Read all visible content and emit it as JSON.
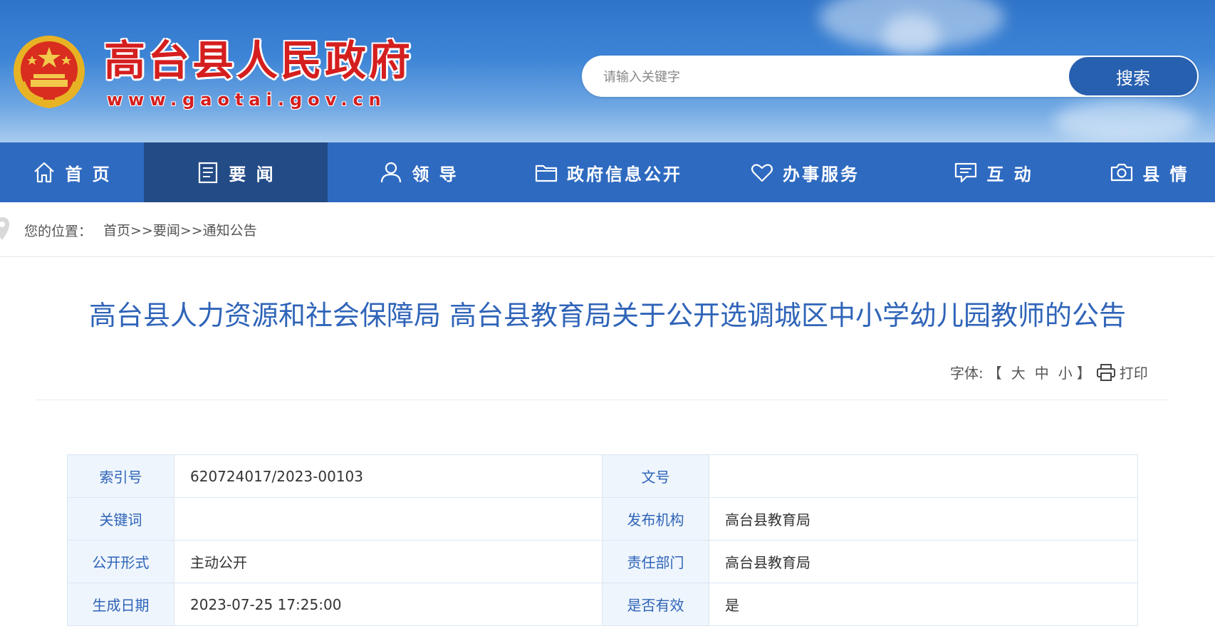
{
  "header": {
    "site_name": "高台县人民政府",
    "site_url": "www.gaotai.gov.cn",
    "colors": {
      "site_name": "#d51e1e",
      "banner": "#2f74c9"
    }
  },
  "search": {
    "placeholder": "请输入关键字",
    "button_label": "搜索"
  },
  "nav": {
    "items": [
      {
        "label": "首 页",
        "icon": "home-icon"
      },
      {
        "label": "要 闻",
        "icon": "news-icon",
        "active": true
      },
      {
        "label": "领 导",
        "icon": "person-icon"
      },
      {
        "label": "政府信息公开",
        "icon": "folder-icon"
      },
      {
        "label": "办事服务",
        "icon": "heart-icon"
      },
      {
        "label": "互 动",
        "icon": "chat-icon"
      },
      {
        "label": "县 情",
        "icon": "camera-icon"
      }
    ],
    "colors": {
      "bar": "#2e6ac0",
      "active": "#234b86"
    }
  },
  "breadcrumb": {
    "label": "您的位置：",
    "path": "首页>>要闻>>通知公告"
  },
  "article": {
    "title": "高台县人力资源和社会保障局 高台县教育局关于公开选调城区中小学幼儿园教师的公告",
    "font_label": "字体:",
    "font_open": "【",
    "font_large": "大",
    "font_medium": "中",
    "font_small": "小",
    "font_close": "】",
    "print_label": "打印"
  },
  "meta": {
    "rows": [
      [
        {
          "label": "索引号",
          "value": "620724017/2023-00103"
        },
        {
          "label": "文号",
          "value": ""
        }
      ],
      [
        {
          "label": "关键词",
          "value": ""
        },
        {
          "label": "发布机构",
          "value": "高台县教育局"
        }
      ],
      [
        {
          "label": "公开形式",
          "value": "主动公开"
        },
        {
          "label": "责任部门",
          "value": "高台县教育局"
        }
      ],
      [
        {
          "label": "生成日期",
          "value": "2023-07-25 17:25:00"
        },
        {
          "label": "是否有效",
          "value": "是"
        }
      ]
    ]
  }
}
